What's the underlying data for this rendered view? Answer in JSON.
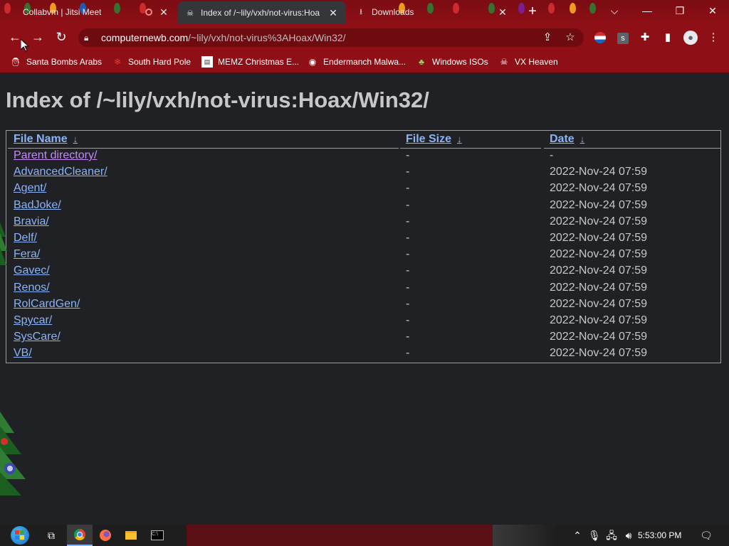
{
  "tabs": [
    {
      "title": "Collabvm | Jitsi Meet",
      "active": false
    },
    {
      "title": "Index of /~lily/vxh/not-virus:Hoa",
      "active": true
    },
    {
      "title": "Downloads",
      "active": false
    }
  ],
  "new_tab": "+",
  "window_controls": {
    "tab_search": "⌵",
    "minimize": "—",
    "restore": "❐",
    "close": "✕"
  },
  "nav": {
    "back": "←",
    "forward": "→",
    "reload": "↻"
  },
  "address_bar": {
    "host": "computernewb.com",
    "path": "/~lily/vxh/not-virus%3AHoax/Win32/"
  },
  "bookmarks": [
    {
      "label": "Santa Bombs Arabs",
      "icon": "santa-icon"
    },
    {
      "label": "South Hard Pole",
      "icon": "snowflake-icon"
    },
    {
      "label": "MEMZ Christmas E...",
      "icon": "page-icon"
    },
    {
      "label": "Endermanch Malwa...",
      "icon": "raccoon-icon"
    },
    {
      "label": "Windows ISOs",
      "icon": "tree-icon"
    },
    {
      "label": "VX Heaven",
      "icon": "skull-icon"
    }
  ],
  "page": {
    "heading": "Index of /~lily/vxh/not-virus:Hoax/Win32/",
    "columns": {
      "name": "File Name",
      "size": "File Size",
      "date": "Date",
      "sort_arrow": "↓"
    },
    "rows": [
      {
        "name": "Parent directory/",
        "size": "-",
        "date": "-",
        "visited": true
      },
      {
        "name": "AdvancedCleaner/",
        "size": "-",
        "date": "2022-Nov-24 07:59",
        "visited": false
      },
      {
        "name": "Agent/",
        "size": "-",
        "date": "2022-Nov-24 07:59",
        "visited": false
      },
      {
        "name": "BadJoke/",
        "size": "-",
        "date": "2022-Nov-24 07:59",
        "visited": false
      },
      {
        "name": "Bravia/",
        "size": "-",
        "date": "2022-Nov-24 07:59",
        "visited": false
      },
      {
        "name": "Delf/",
        "size": "-",
        "date": "2022-Nov-24 07:59",
        "visited": false
      },
      {
        "name": "Fera/",
        "size": "-",
        "date": "2022-Nov-24 07:59",
        "visited": false
      },
      {
        "name": "Gavec/",
        "size": "-",
        "date": "2022-Nov-24 07:59",
        "visited": false
      },
      {
        "name": "Renos/",
        "size": "-",
        "date": "2022-Nov-24 07:59",
        "visited": false
      },
      {
        "name": "RolCardGen/",
        "size": "-",
        "date": "2022-Nov-24 07:59",
        "visited": false
      },
      {
        "name": "Spycar/",
        "size": "-",
        "date": "2022-Nov-24 07:59",
        "visited": false
      },
      {
        "name": "SysCare/",
        "size": "-",
        "date": "2022-Nov-24 07:59",
        "visited": false
      },
      {
        "name": "VB/",
        "size": "-",
        "date": "2022-Nov-24 07:59",
        "visited": false
      }
    ]
  },
  "taskbar": {
    "clock": "5:53:00 PM"
  },
  "colors": {
    "chrome_red": "#8e1016",
    "page_bg": "#202124",
    "link": "#8ab4f8",
    "visited": "#c58af9",
    "text": "#c7c7c7"
  }
}
